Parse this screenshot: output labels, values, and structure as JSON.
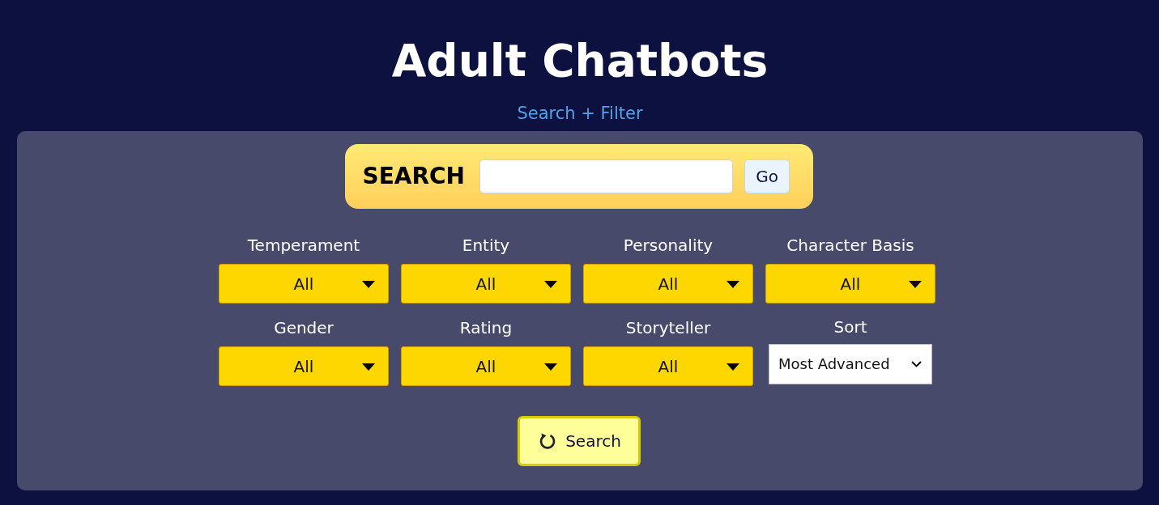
{
  "header": {
    "title": "Adult Chatbots",
    "subtitle": "Search + Filter"
  },
  "search": {
    "label": "SEARCH",
    "button": "Go"
  },
  "filters": [
    {
      "kind": "dropdown",
      "label": "Temperament",
      "value": "All"
    },
    {
      "kind": "dropdown",
      "label": "Entity",
      "value": "All"
    },
    {
      "kind": "dropdown",
      "label": "Personality",
      "value": "All"
    },
    {
      "kind": "dropdown",
      "label": "Character Basis",
      "value": "All"
    },
    {
      "kind": "dropdown",
      "label": "Gender",
      "value": "All"
    },
    {
      "kind": "dropdown",
      "label": "Rating",
      "value": "All"
    },
    {
      "kind": "dropdown",
      "label": "Storyteller",
      "value": "All"
    },
    {
      "kind": "select",
      "label": "Sort",
      "value": "Most Advanced"
    }
  ],
  "submit": {
    "label": "Search"
  }
}
